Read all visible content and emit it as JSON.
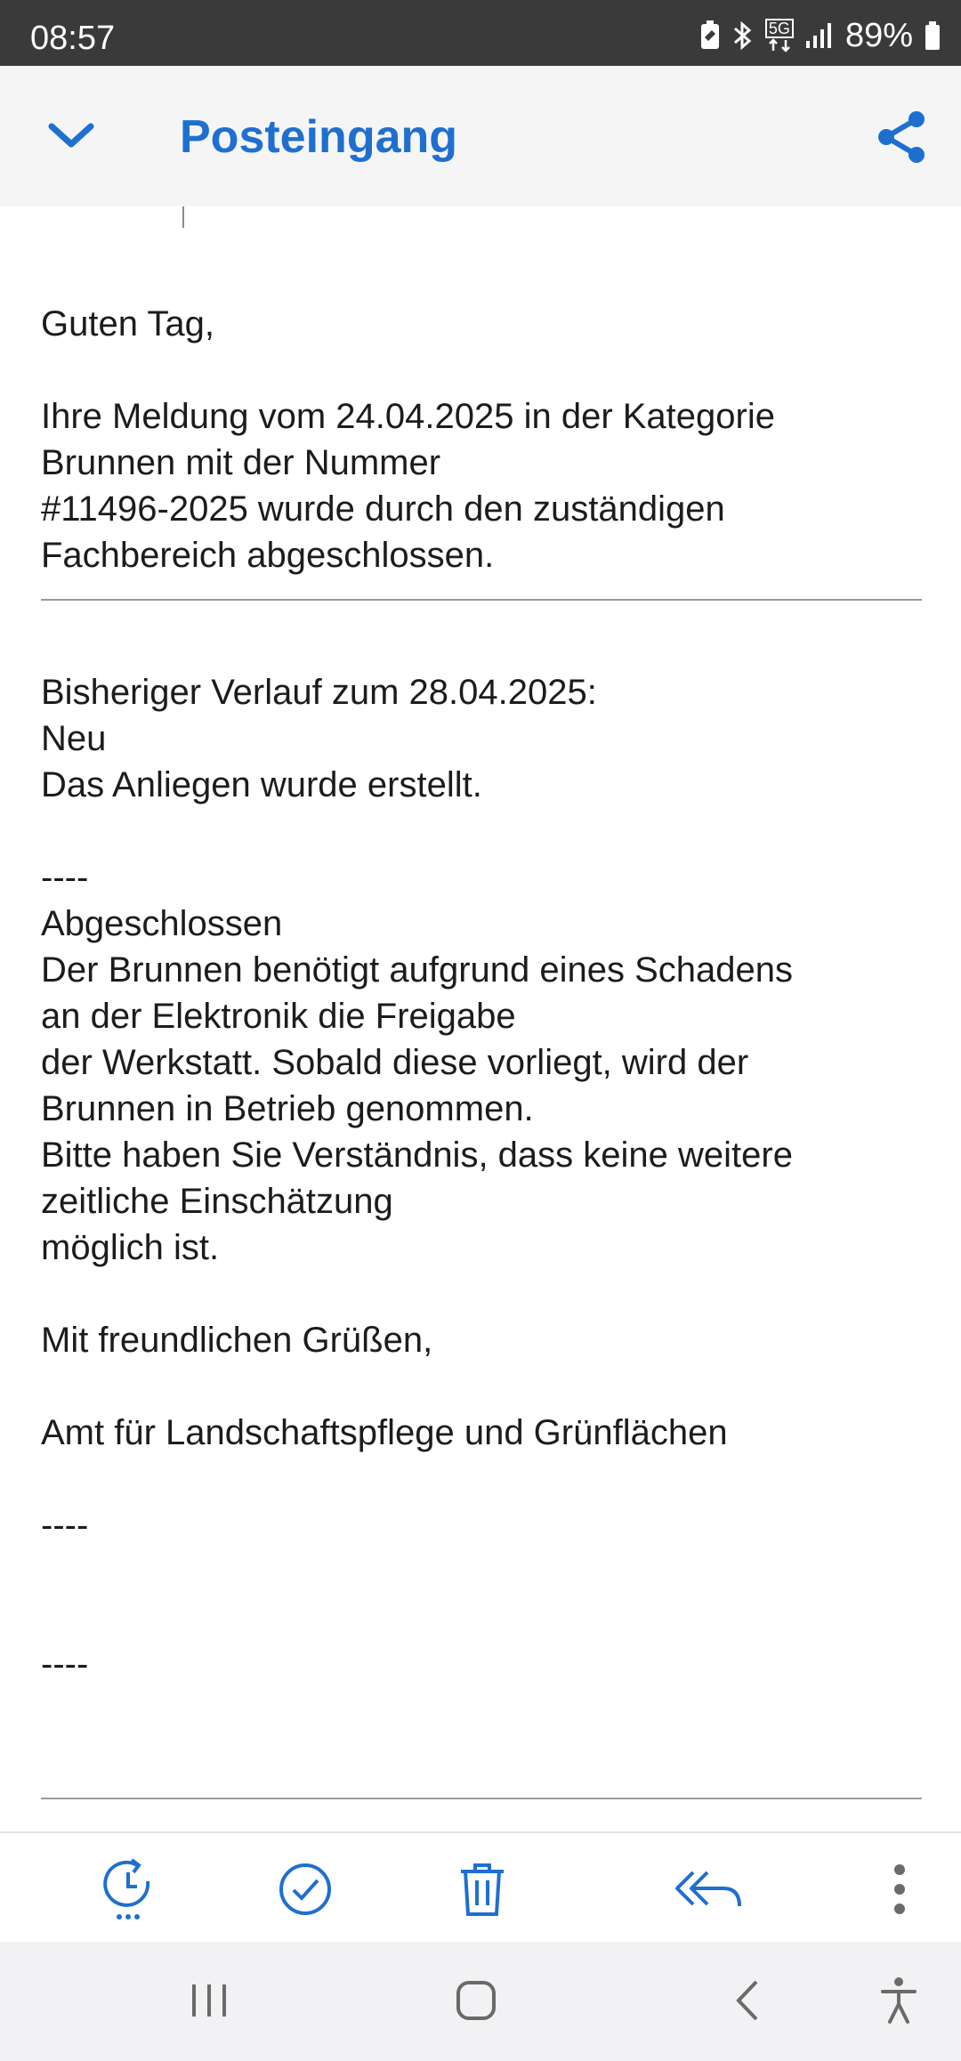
{
  "status_bar": {
    "time": "08:57",
    "network": "5G",
    "battery_percent": "89%"
  },
  "header": {
    "title": "Posteingang",
    "back_icon": "chevron-down-icon",
    "share_icon": "share-icon"
  },
  "email": {
    "greeting": "Guten Tag,",
    "intro_lines": [
      "Ihre Meldung vom 24.04.2025 in der Kategorie",
      "Brunnen mit der Nummer",
      "#11496-2025 wurde durch den zuständigen",
      "Fachbereich abgeschlossen."
    ],
    "history_heading": "Bisheriger Verlauf zum 28.04.2025:",
    "history_entries": [
      {
        "status": "Neu",
        "lines": [
          "Das Anliegen wurde erstellt."
        ]
      },
      {
        "status": "Abgeschlossen",
        "lines": [
          "Der Brunnen benötigt aufgrund eines Schadens",
          "an der Elektronik die Freigabe",
          "der Werkstatt. Sobald diese vorliegt, wird der",
          "Brunnen in Betrieb genommen.",
          "Bitte haben Sie Verständnis, dass keine weitere",
          "zeitliche Einschätzung",
          "möglich ist."
        ]
      }
    ],
    "separator": "----",
    "closing": "Mit freundlichen Grüßen,",
    "sender": "Amt für Landschaftspflege und Grünflächen"
  },
  "toolbar": {
    "items": [
      "snooze-icon",
      "mark-done-icon",
      "delete-icon",
      "reply-all-icon",
      "more-options-icon"
    ]
  },
  "nav_bar": {
    "items": [
      "recent-apps-icon",
      "home-icon",
      "back-icon",
      "accessibility-icon"
    ]
  },
  "colors": {
    "accent": "#1f6fd0",
    "status_bar_bg": "#3a3a3a",
    "app_bar_bg": "#f5f5f6",
    "nav_bar_bg": "#f2f2f4"
  }
}
